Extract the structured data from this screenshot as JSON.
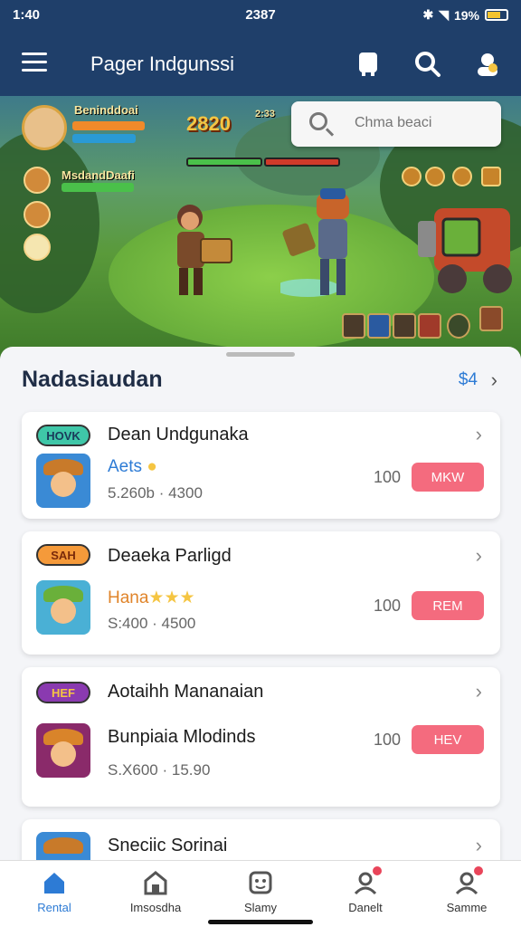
{
  "status": {
    "time": "1:40",
    "center": "2387",
    "battery": "19%"
  },
  "header": {
    "title": "Pager Indgunssi"
  },
  "hero": {
    "search_placeholder": "Chma beaci",
    "score": "2820",
    "player_tag": "Beninddoai",
    "player2_tag": "MsdandDaafi",
    "mini_tag": "2:33"
  },
  "section": {
    "title": "Nadasiaudan",
    "count": "$4"
  },
  "cards": [
    {
      "badge": "HOVK",
      "title": "Dean Undgunaka",
      "subtitle": "Aets",
      "meta": "5.260b · 4300",
      "price": "100",
      "button": "MKW"
    },
    {
      "badge": "SAH",
      "title": "Deaeka Parligd",
      "subtitle": "Hana",
      "meta": "S:400 · 4500",
      "price": "100",
      "button": "REM"
    },
    {
      "badge": "HEF",
      "title": "Aotaihh Mananaian",
      "subtitle": "Bunpiaia Mlodinds",
      "meta": "S.X600 · 15.90",
      "price": "100",
      "button": "HEV"
    },
    {
      "title": "Sneciic Sorinai"
    }
  ],
  "nav": [
    {
      "label": "Rental",
      "icon": "home-icon",
      "active": true
    },
    {
      "label": "Imsosdha",
      "icon": "store-icon"
    },
    {
      "label": "Slamy",
      "icon": "game-icon"
    },
    {
      "label": "Danelt",
      "icon": "user-icon"
    },
    {
      "label": "Samme",
      "icon": "profile-icon"
    }
  ],
  "colors": {
    "header": "#1f3f6a",
    "accent": "#2d7bd5",
    "button": "#f46b7e",
    "nav_active": "#2d7bd5"
  }
}
